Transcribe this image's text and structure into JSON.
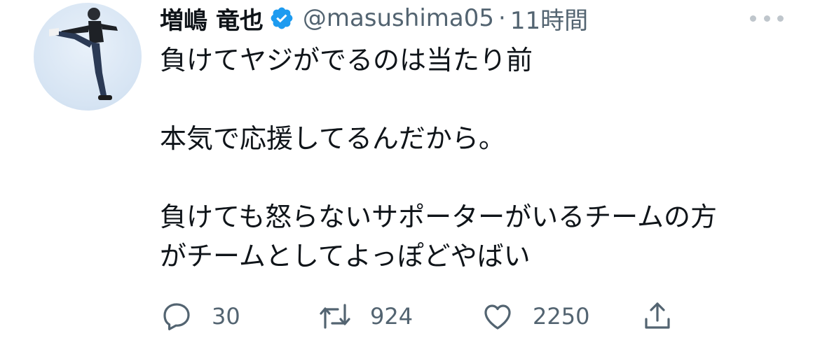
{
  "tweet": {
    "author_name": "増嶋 竜也",
    "handle": "@masushima05",
    "separator": "·",
    "timestamp": "11時間",
    "verified": true,
    "paragraphs": [
      [
        "負けてヤジがでるのは当たり前"
      ],
      [
        "本気で応援してるんだから。"
      ],
      [
        "負けても怒らないサポーターがいるチームの方",
        "がチームとしてよっぽどやばい"
      ]
    ]
  },
  "actions": {
    "reply_count": "30",
    "retweet_count": "924",
    "like_count": "2250"
  },
  "icons": {
    "verified": "verified-badge-icon",
    "more": "more-options-icon",
    "reply": "reply-icon",
    "retweet": "retweet-icon",
    "like": "heart-icon",
    "share": "share-icon"
  },
  "colors": {
    "verified_blue": "#1d9bf0",
    "text_primary": "#0f1419",
    "text_secondary": "#536471"
  }
}
